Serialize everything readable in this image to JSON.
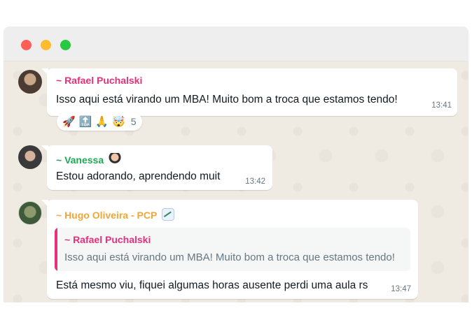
{
  "messages": [
    {
      "sender": "~ Rafael Puchalski",
      "text": "Isso aqui está virando um MBA! Muito bom a troca que estamos tendo!",
      "time": "13:41",
      "reactions": [
        "🚀",
        "🔝",
        "🙏",
        "🤯"
      ],
      "reaction_count": "5"
    },
    {
      "sender": "~ Vanessa",
      "sender_emoji": "person-emoji",
      "text": "Estou adorando, aprendendo muit",
      "time": "13:42"
    },
    {
      "sender": "~ Hugo Oliveira - PCP",
      "sender_emoji": "chart-increasing-emoji",
      "quoted": {
        "sender": "~ Rafael Puchalski",
        "text": "Isso aqui está virando um MBA! Muito bom a troca que estamos tendo!"
      },
      "text": "Está mesmo viu, fiquei algumas horas ausente perdi uma aula rs",
      "time": "13:47"
    }
  ],
  "colors": {
    "rafael": "#e8307a",
    "vanessa": "#1fa855",
    "hugo": "#f1a637",
    "chat_bg": "#efeae2"
  }
}
